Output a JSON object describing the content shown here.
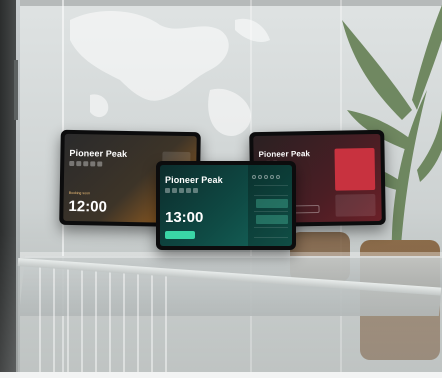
{
  "colors": {
    "left_screen_accent": "#b06a1e",
    "center_screen_accent": "#16685d",
    "right_screen_accent": "#6b2028",
    "center_button": "#3ad6a6"
  },
  "devices": {
    "left": {
      "room_name": "Pioneer Peak",
      "status_label": "Booking soon",
      "time": "12:00"
    },
    "center": {
      "room_name": "Pioneer Peak",
      "time": "13:00"
    },
    "right": {
      "room_name": "Pioneer Peak"
    }
  }
}
